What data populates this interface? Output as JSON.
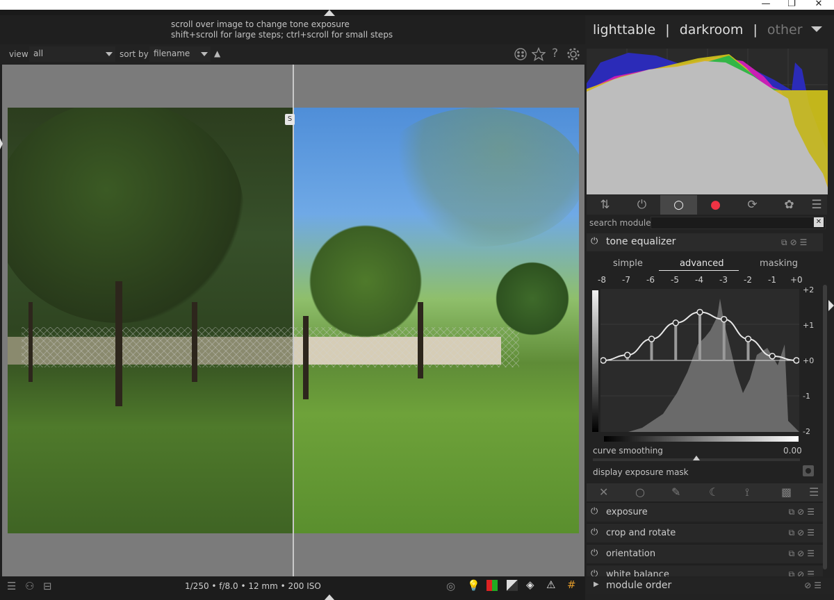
{
  "window": {
    "minimize": "—",
    "restore": "❐",
    "close": "✕"
  },
  "hint": {
    "line1": "scroll over image to change tone exposure",
    "line2": "shift+scroll for large steps; ctrl+scroll for small steps"
  },
  "filter": {
    "view_label": "view",
    "view_value": "all",
    "sort_label": "sort by",
    "sort_value": "filename",
    "sort_dir": "▲"
  },
  "split": {
    "knob": "S"
  },
  "bottom": {
    "info": "1/250 • f/8.0 • 12 mm • 200 ISO",
    "pickers": [
      "◎",
      "💡",
      "▦",
      "◪",
      "◈",
      "⚠",
      "#"
    ]
  },
  "views": {
    "lighttable": "lighttable",
    "sep": "|",
    "darkroom": "darkroom",
    "other": "other"
  },
  "modules": {
    "search_label": "search module",
    "tabs": [
      "⇅",
      "⏻",
      "○",
      "●",
      "⟳",
      "✿",
      "☰"
    ]
  },
  "tone_equalizer": {
    "title": "tone equalizer",
    "subtabs": [
      "simple",
      "advanced",
      "masking"
    ],
    "x_ticks": [
      "-8",
      "-7",
      "-6",
      "-5",
      "-4",
      "-3",
      "-2",
      "-1",
      "+0"
    ],
    "y_ticks": [
      "+2",
      "+1",
      "+0",
      "-1",
      "-2"
    ],
    "curve_smoothing_label": "curve smoothing",
    "curve_smoothing_value": "0.00",
    "display_mask_label": "display exposure mask",
    "node_values": [
      0.0,
      0.15,
      0.6,
      1.05,
      1.35,
      1.15,
      0.6,
      0.12,
      0.0
    ]
  },
  "tools": [
    "✕",
    "○",
    "✎",
    "☾",
    "⟟",
    "▩",
    "☰"
  ],
  "module_list": [
    {
      "name": "exposure"
    },
    {
      "name": "crop and rotate"
    },
    {
      "name": "orientation"
    },
    {
      "name": "white balance"
    }
  ],
  "module_order": "module order",
  "colors": {
    "accent": "#e5e5e5",
    "panel": "#222222",
    "plot": "#2b2b2b"
  }
}
